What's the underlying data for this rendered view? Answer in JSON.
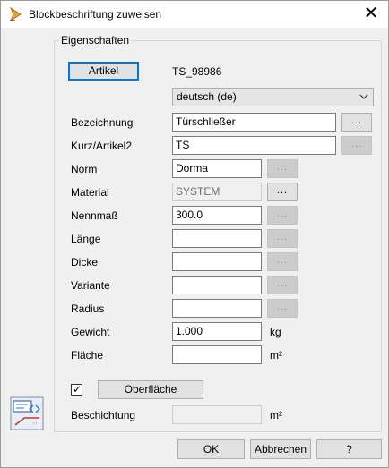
{
  "window": {
    "title": "Blockbeschriftung zuweisen",
    "close_glyph": "✕"
  },
  "group": {
    "label": "Eigenschaften"
  },
  "article": {
    "button_label": "Artikel",
    "id": "TS_98986"
  },
  "language": {
    "selected": "deutsch (de)"
  },
  "browse_glyph": "...",
  "fields": {
    "bezeichnung": {
      "label": "Bezeichnung",
      "value": "Türschließer"
    },
    "kurz": {
      "label": "Kurz/Artikel2",
      "value": "TS"
    },
    "norm": {
      "label": "Norm",
      "value": "Dorma"
    },
    "material": {
      "label": "Material",
      "value": "SYSTEM"
    },
    "nennmass": {
      "label": "Nennmaß",
      "value": "300.0"
    },
    "laenge": {
      "label": "Länge",
      "value": ""
    },
    "dicke": {
      "label": "Dicke",
      "value": ""
    },
    "variante": {
      "label": "Variante",
      "value": ""
    },
    "radius": {
      "label": "Radius",
      "value": ""
    },
    "gewicht": {
      "label": "Gewicht",
      "value": "1.000",
      "unit": "kg"
    },
    "flaeche": {
      "label": "Fläche",
      "value": "",
      "unit": "m²"
    }
  },
  "surface": {
    "checked": true,
    "check_glyph": "✓",
    "button_label": "Oberfläche"
  },
  "beschichtung": {
    "label": "Beschichtung",
    "value": "",
    "unit": "m²"
  },
  "footer": {
    "ok_label": "OK",
    "cancel_label": "Abbrechen",
    "help_label": "?"
  },
  "colors": {
    "accent": "#0078d7",
    "title_icon": "#e8a23a"
  }
}
